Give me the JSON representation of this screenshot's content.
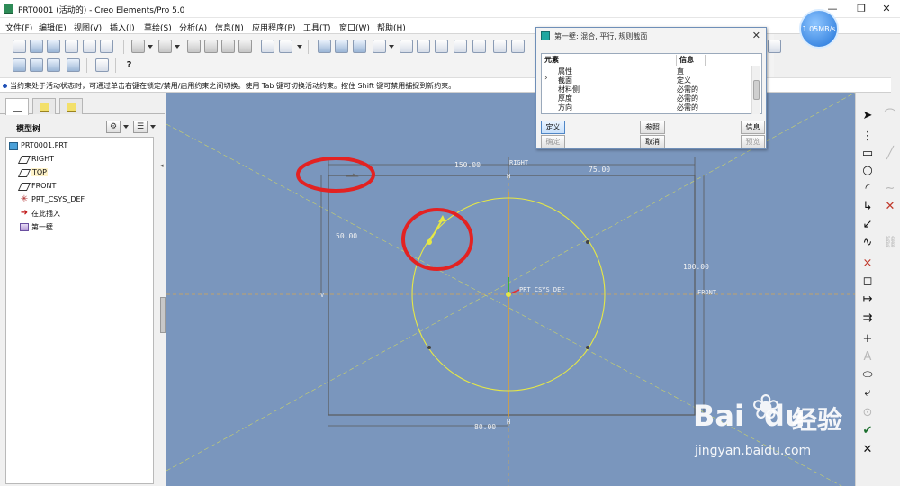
{
  "window": {
    "title": "PRT0001 (活动的) - Creo Elements/Pro 5.0",
    "minimize": "—",
    "restore": "❐",
    "close": "✕"
  },
  "menu": [
    "文件(F)",
    "编辑(E)",
    "视图(V)",
    "插入(I)",
    "草绘(S)",
    "分析(A)",
    "信息(N)",
    "应用程序(P)",
    "工具(T)",
    "窗口(W)",
    "帮助(H)"
  ],
  "status_message": "当约束处于活动状态时，可通过单击右键在锁定/禁用/启用约束之间切换。使用 Tab 键可切换活动约束。按住 Shift 键可禁用捕捉到新约束。",
  "network_speed": "1.05MB/s",
  "model_tree": {
    "title": "模型树",
    "nodes": [
      {
        "label": "PRT0001.PRT",
        "icon": "part-icon",
        "selected": false
      },
      {
        "label": "RIGHT",
        "icon": "datum-plane-icon",
        "selected": false
      },
      {
        "label": "TOP",
        "icon": "datum-plane-icon",
        "selected": true
      },
      {
        "label": "FRONT",
        "icon": "datum-plane-icon",
        "selected": false
      },
      {
        "label": "PRT_CSYS_DEF",
        "icon": "csys-icon",
        "selected": false
      },
      {
        "label": "在此插入",
        "icon": "insert-arrow-icon",
        "selected": false
      },
      {
        "label": "第一壁",
        "icon": "wall-feature-icon",
        "selected": false
      }
    ]
  },
  "dialog": {
    "title": "第一壁: 混合, 平行, 规则截面",
    "columns": [
      "元素",
      "信息"
    ],
    "rows": [
      {
        "element": "属性",
        "info": "直"
      },
      {
        "element": "截面",
        "info": "定义"
      },
      {
        "element": "材料侧",
        "info": "必需的"
      },
      {
        "element": "厚度",
        "info": "必需的"
      },
      {
        "element": "方向",
        "info": "必需的"
      }
    ],
    "buttons": {
      "define": "定义",
      "reference": "参照",
      "info": "信息",
      "ok": "确定",
      "cancel": "取消",
      "preview": "预览"
    }
  },
  "sketch": {
    "dimensions": {
      "top_left": "150.00",
      "top_right": "75.00",
      "left_vertical": "50.00",
      "right_vertical": "100.00",
      "bottom": "80.00"
    },
    "refs": {
      "right_plane": "RIGHT",
      "front_plane": "FRONT",
      "csys": "PRT_CSYS_DEF",
      "v_left": "V",
      "h_bottom": "H",
      "h_top": "H"
    }
  },
  "watermark": {
    "brand": "Bai",
    "brand2": "du",
    "cn": "经验",
    "url": "jingyan.baidu.com"
  },
  "colors": {
    "canvas": "#7a96bd",
    "sketch": "#e6e845",
    "highlight": "#e32222",
    "dim": "#5a5a5a"
  }
}
